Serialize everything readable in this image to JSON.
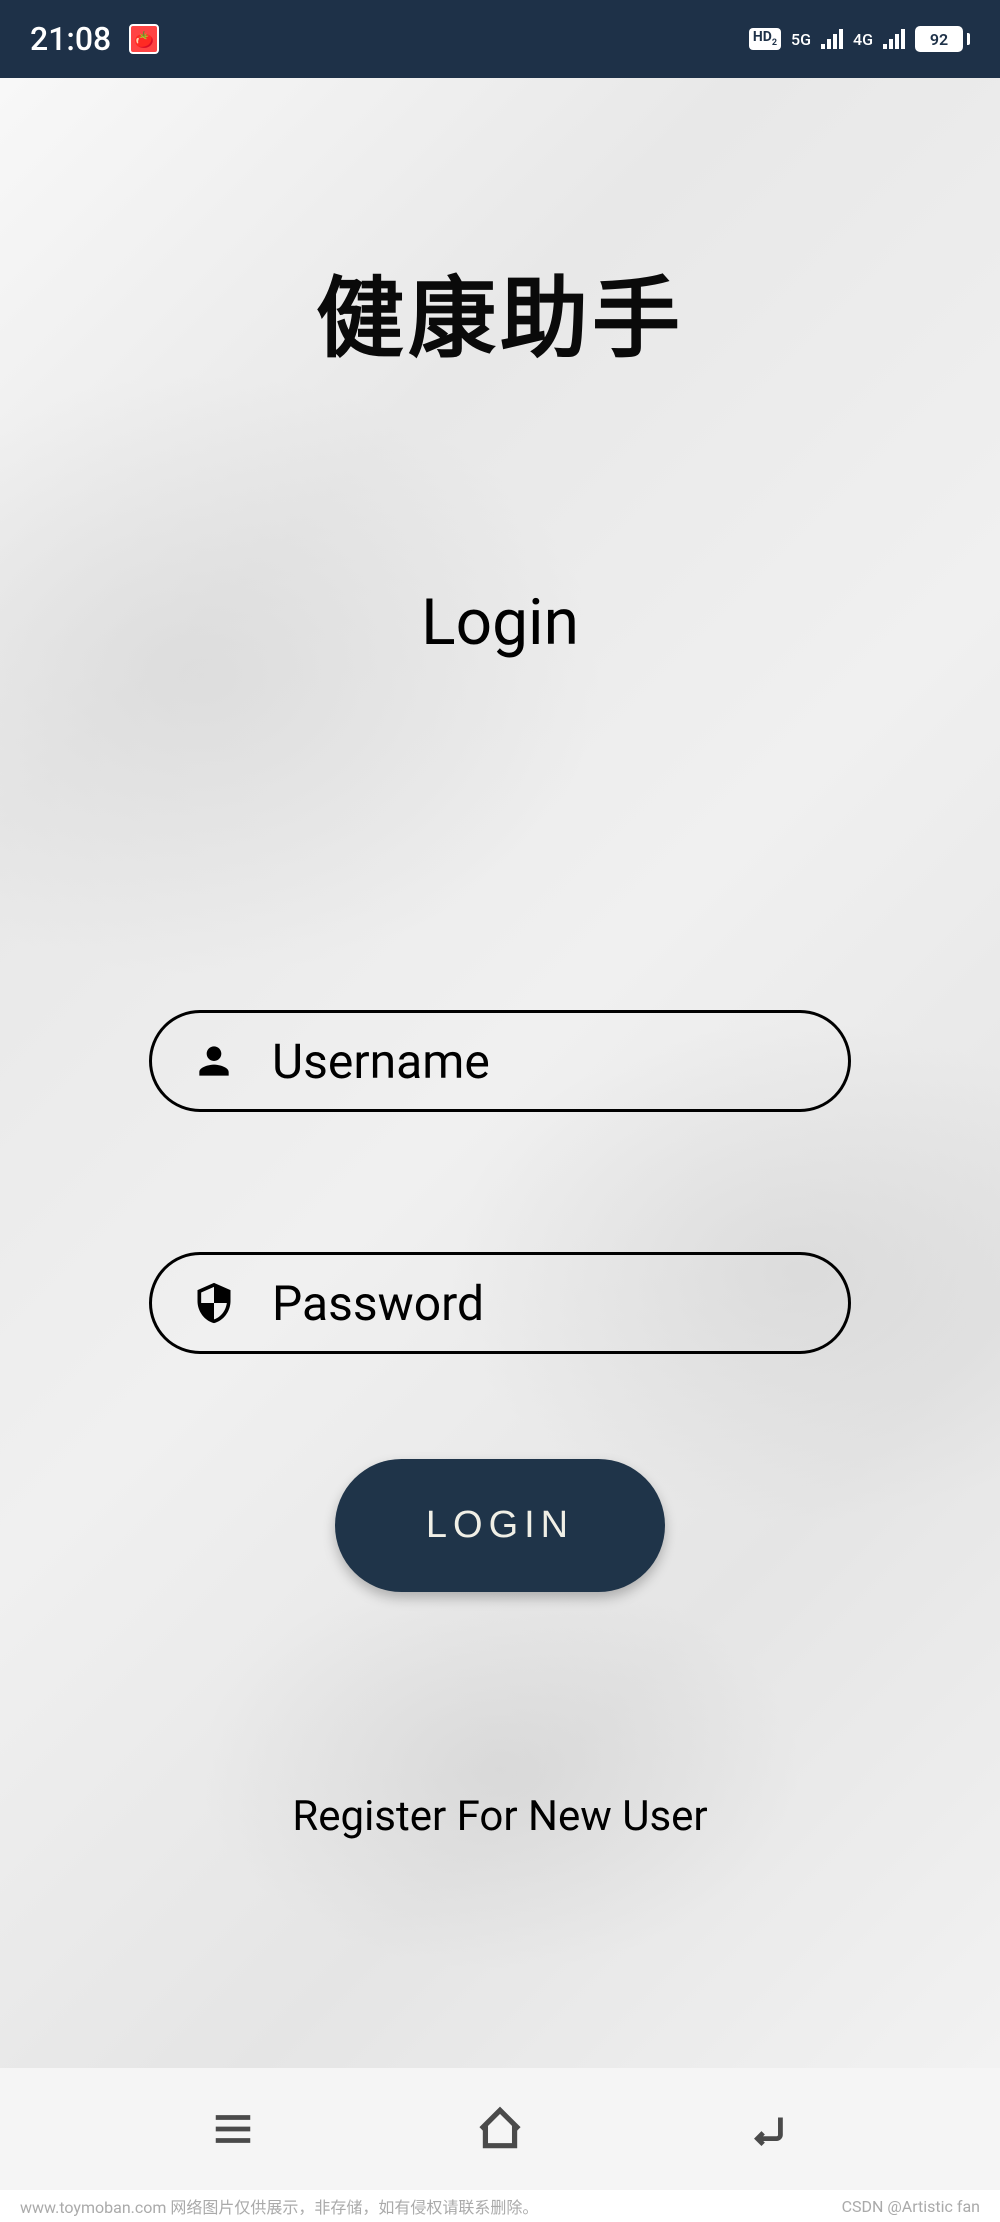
{
  "status_bar": {
    "time": "21:08",
    "hd_label": "HD",
    "hd_sub": "2",
    "network_5g": "5G",
    "network_4g": "4G",
    "battery_level": "92"
  },
  "app": {
    "title": "健康助手",
    "login_heading": "Login"
  },
  "form": {
    "username_placeholder": "Username",
    "password_placeholder": "Password",
    "login_button_label": "LOGIN",
    "register_link_text": "Register For New User"
  },
  "footer": {
    "left_text": "www.toymoban.com 网络图片仅供展示，非存储，如有侵权请联系删除。",
    "right_text": "CSDN @Artistic fan"
  },
  "colors": {
    "status_bar_bg": "#1e3148",
    "login_button_bg": "#1f3449",
    "login_button_text": "#f0efe6"
  }
}
